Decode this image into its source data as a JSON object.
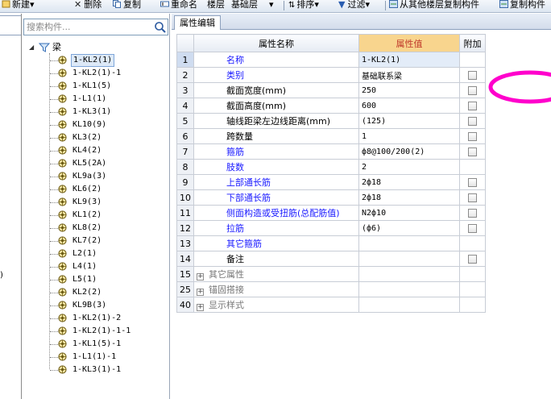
{
  "toolbar": {
    "new_label": "新建",
    "delete_label": "删除",
    "copy_label": "复制",
    "rename_label": "重命名",
    "floor_label": "楼层",
    "floor_value": "基础层",
    "sort_label": "排序",
    "filter_label": "过滤",
    "copy_from_floor_label": "从其他楼层复制构件",
    "copy_to_floor_label": "复制构件"
  },
  "left_strip_glyph": ")",
  "search": {
    "placeholder": "搜索构件..."
  },
  "tree": {
    "root_label": "梁",
    "items": [
      "1-KL2(1)",
      "1-KL2(1)-1",
      "1-KL1(5)",
      "1-L1(1)",
      "1-KL3(1)",
      "KL10(9)",
      "KL3(2)",
      "KL4(2)",
      "KL5(2A)",
      "KL9a(3)",
      "KL6(2)",
      "KL9(3)",
      "KL1(2)",
      "KL8(2)",
      "KL7(2)",
      "L2(1)",
      "L4(1)",
      "L5(1)",
      "KL2(2)",
      "KL9B(3)",
      "1-KL2(1)-2",
      "1-KL2(1)-1-1",
      "1-KL1(5)-1",
      "1-L1(1)-1",
      "1-KL3(1)-1"
    ],
    "selected_index": 0
  },
  "props": {
    "tab_label": "属性编辑",
    "headers": {
      "name": "属性名称",
      "value": "属性值",
      "extra": "附加"
    },
    "rows": [
      {
        "num": "1",
        "name": "名称",
        "value": "1-KL2(1)",
        "blue": true,
        "check": false
      },
      {
        "num": "2",
        "name": "类别",
        "value": "基础联系梁",
        "blue": true,
        "check": true
      },
      {
        "num": "3",
        "name": "截面宽度(mm)",
        "value": "250",
        "blue": false,
        "check": true
      },
      {
        "num": "4",
        "name": "截面高度(mm)",
        "value": "600",
        "blue": false,
        "check": true
      },
      {
        "num": "5",
        "name": "轴线距梁左边线距离(mm)",
        "value": "(125)",
        "blue": false,
        "check": true
      },
      {
        "num": "6",
        "name": "跨数量",
        "value": "1",
        "blue": false,
        "check": true
      },
      {
        "num": "7",
        "name": "箍筋",
        "value": "ф8@100/200(2)",
        "blue": true,
        "check": true
      },
      {
        "num": "8",
        "name": "肢数",
        "value": "2",
        "blue": true,
        "check": false
      },
      {
        "num": "9",
        "name": "上部通长筋",
        "value": "2ф18",
        "blue": true,
        "check": true
      },
      {
        "num": "10",
        "name": "下部通长筋",
        "value": "2ф18",
        "blue": true,
        "check": true
      },
      {
        "num": "11",
        "name": "侧面构造或受扭筋(总配筋值)",
        "value": "N2ф10",
        "blue": true,
        "check": true
      },
      {
        "num": "12",
        "name": "拉筋",
        "value": "(ф6)",
        "blue": true,
        "check": true
      },
      {
        "num": "13",
        "name": "其它箍筋",
        "value": "",
        "blue": true,
        "check": false
      },
      {
        "num": "14",
        "name": "备注",
        "value": "",
        "blue": false,
        "check": true
      }
    ],
    "groups": [
      {
        "num": "15",
        "name": "其它属性"
      },
      {
        "num": "25",
        "name": "锚固搭接"
      },
      {
        "num": "40",
        "name": "显示样式"
      }
    ],
    "selected_row": 0
  },
  "colors": {
    "highlight_ring": "#ff00cc",
    "header_value_bg": "#f8d58e",
    "header_value_text": "#c0392b",
    "blue_property_text": "#1a1aff"
  }
}
